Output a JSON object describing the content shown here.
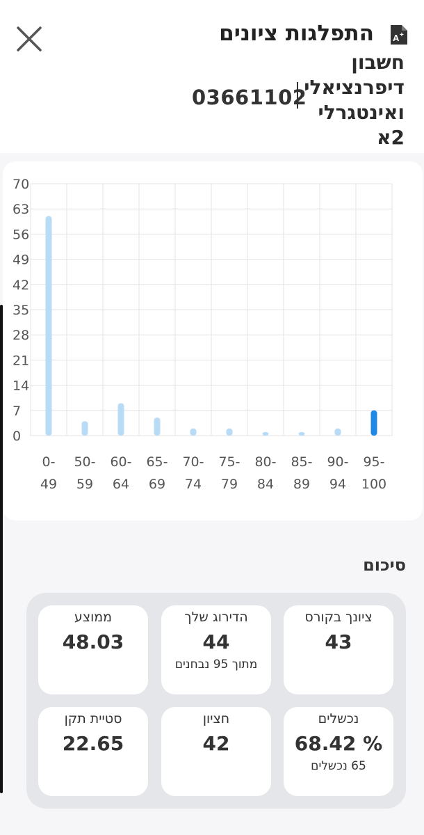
{
  "header": {
    "title": "התפלגות ציונים",
    "course_name": "חשבון דיפרנציאלי ואינטגרלי 2א",
    "course_code": "03661102",
    "icons": {
      "close": "close-icon",
      "document": "document-grade-icon"
    }
  },
  "chart_data": {
    "type": "bar",
    "categories": [
      "0-49",
      "50-59",
      "60-64",
      "65-69",
      "70-74",
      "75-79",
      "80-84",
      "85-89",
      "90-94",
      "95-100"
    ],
    "values": [
      61,
      4,
      9,
      5,
      2,
      2,
      1,
      1,
      2,
      7
    ],
    "highlight_index": 9,
    "ylim": [
      0,
      70
    ],
    "yticks": [
      0,
      7,
      14,
      21,
      28,
      35,
      42,
      49,
      56,
      63,
      70
    ],
    "grid": true,
    "colors": {
      "bar": "#b9dcf6",
      "highlight": "#1e88e5",
      "grid": "#e3e3e3"
    }
  },
  "summary": {
    "title": "סיכום",
    "stats": [
      {
        "label": "ציונך בקורס",
        "value": "43",
        "sub": ""
      },
      {
        "label": "הדירוג שלך",
        "value": "44",
        "sub": "מתוך 95 נבחנים"
      },
      {
        "label": "ממוצע",
        "value": "48.03",
        "sub": ""
      },
      {
        "label": "נכשלים",
        "value": "% 68.42",
        "sub": "65 נכשלים"
      },
      {
        "label": "חציון",
        "value": "42",
        "sub": ""
      },
      {
        "label": "סטיית תקן",
        "value": "22.65",
        "sub": ""
      }
    ]
  }
}
